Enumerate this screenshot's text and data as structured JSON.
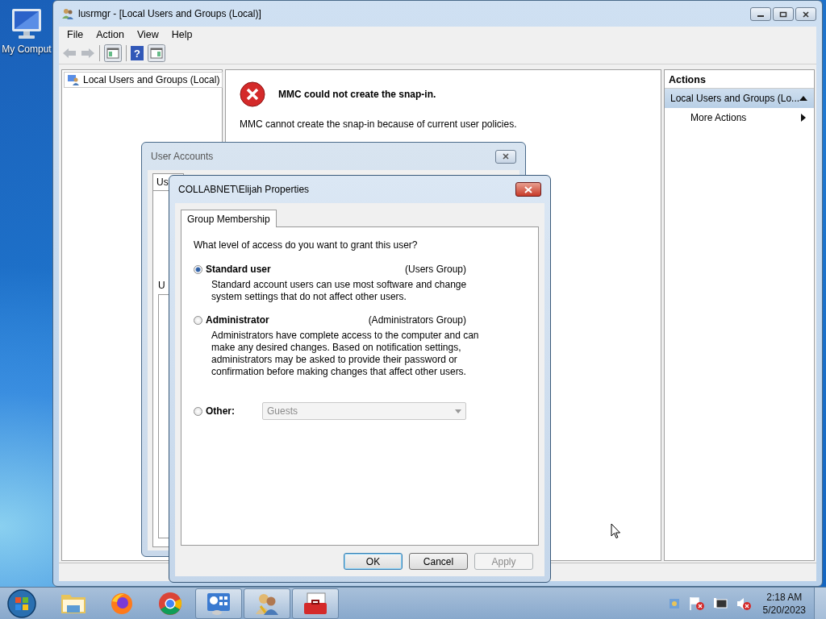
{
  "desktop": {
    "icons": [
      {
        "label": "My Comput"
      }
    ]
  },
  "mmc": {
    "title": "lusrmgr - [Local Users and Groups (Local)]",
    "menu": [
      "File",
      "Action",
      "View",
      "Help"
    ],
    "help_glyph": "?",
    "tree": [
      {
        "label": "Local Users and Groups (Local)"
      }
    ],
    "error": {
      "heading": "MMC could not create the snap-in.",
      "message": "MMC cannot create the snap-in because of current user policies."
    },
    "actions": {
      "header": "Actions",
      "section": "Local Users and Groups (Lo...",
      "items": [
        "More Actions"
      ]
    }
  },
  "user_accounts": {
    "title": "User Accounts",
    "tab": "Us",
    "label": "U"
  },
  "properties": {
    "title": "COLLABNET\\Elijah Properties",
    "tabs": [
      {
        "label": "Group Membership",
        "selected": true
      }
    ],
    "question": "What level of access do you want to grant this user?",
    "options": [
      {
        "kind": "radio",
        "label": "Standard user",
        "group": "(Users Group)",
        "description": "Standard account users can use most software and change system settings that do not affect other users.",
        "selected": true
      },
      {
        "kind": "radio",
        "label": "Administrator",
        "group": "(Administrators Group)",
        "description": "Administrators have complete access to the computer and can make any desired changes. Based on notification settings, administrators may be asked to provide their password or confirmation before making changes that affect other users.",
        "selected": false
      },
      {
        "kind": "dropdown",
        "label": "Other:",
        "value": "Guests",
        "disabled": true,
        "selected": false
      }
    ],
    "buttons": [
      {
        "label": "OK",
        "default": true,
        "disabled": false
      },
      {
        "label": "Cancel",
        "default": false,
        "disabled": false
      },
      {
        "label": "Apply",
        "default": false,
        "disabled": true
      }
    ]
  },
  "taskbar": {
    "apps": [
      {
        "kind": "explorer",
        "running": false
      },
      {
        "kind": "firefox",
        "running": false
      },
      {
        "kind": "chrome",
        "running": false
      },
      {
        "kind": "control-panel",
        "running": true
      },
      {
        "kind": "users",
        "running": true
      },
      {
        "kind": "toolbox",
        "running": true
      }
    ],
    "time": "2:18 AM",
    "date": "5/20/2023"
  }
}
